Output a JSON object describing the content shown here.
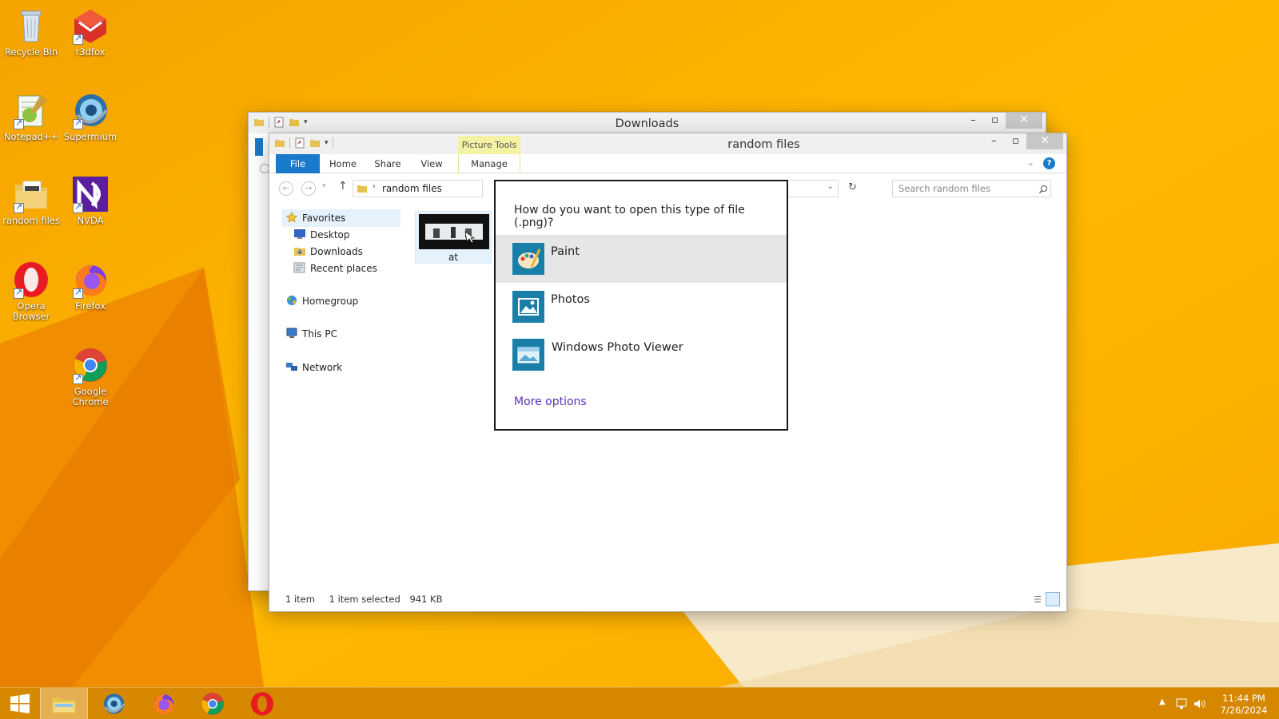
{
  "desktop": {
    "icons": [
      {
        "label": "Recycle Bin"
      },
      {
        "label": "r3dfox"
      },
      {
        "label": "Notepad++"
      },
      {
        "label": "Supermium"
      },
      {
        "label": "random files"
      },
      {
        "label": "NVDA"
      },
      {
        "label": "Opera Browser"
      },
      {
        "label": "Firefox"
      },
      {
        "label": "Google Chrome"
      }
    ]
  },
  "downloads_window": {
    "title": "Downloads"
  },
  "random_window": {
    "title": "random files",
    "context_tab": "Picture Tools",
    "tabs": [
      "File",
      "Home",
      "Share",
      "View",
      "Manage"
    ],
    "breadcrumb": "random files",
    "search_placeholder": "Search random files",
    "nav": {
      "favorites": "Favorites",
      "desktop": "Desktop",
      "downloads": "Downloads",
      "recent": "Recent places",
      "homegroup": "Homegroup",
      "this_pc": "This PC",
      "network": "Network"
    },
    "file_item": {
      "label": "at"
    },
    "status": {
      "count": "1 item",
      "selected": "1 item selected",
      "size": "941 KB"
    }
  },
  "open_with_dialog": {
    "question": "How do you want to open this type of file (.png)?",
    "apps": [
      {
        "name": "Paint",
        "selected": true
      },
      {
        "name": "Photos",
        "selected": false
      },
      {
        "name": "Windows Photo Viewer",
        "selected": false
      }
    ],
    "more_options": "More options"
  },
  "taskbar": {
    "time": "11:44 PM",
    "date": "7/26/2024"
  },
  "colors": {
    "accent_file_tab": "#1979ca",
    "picture_tools": "#f5f2a4",
    "link": "#5b32b7",
    "taskbar": "#d28400"
  }
}
